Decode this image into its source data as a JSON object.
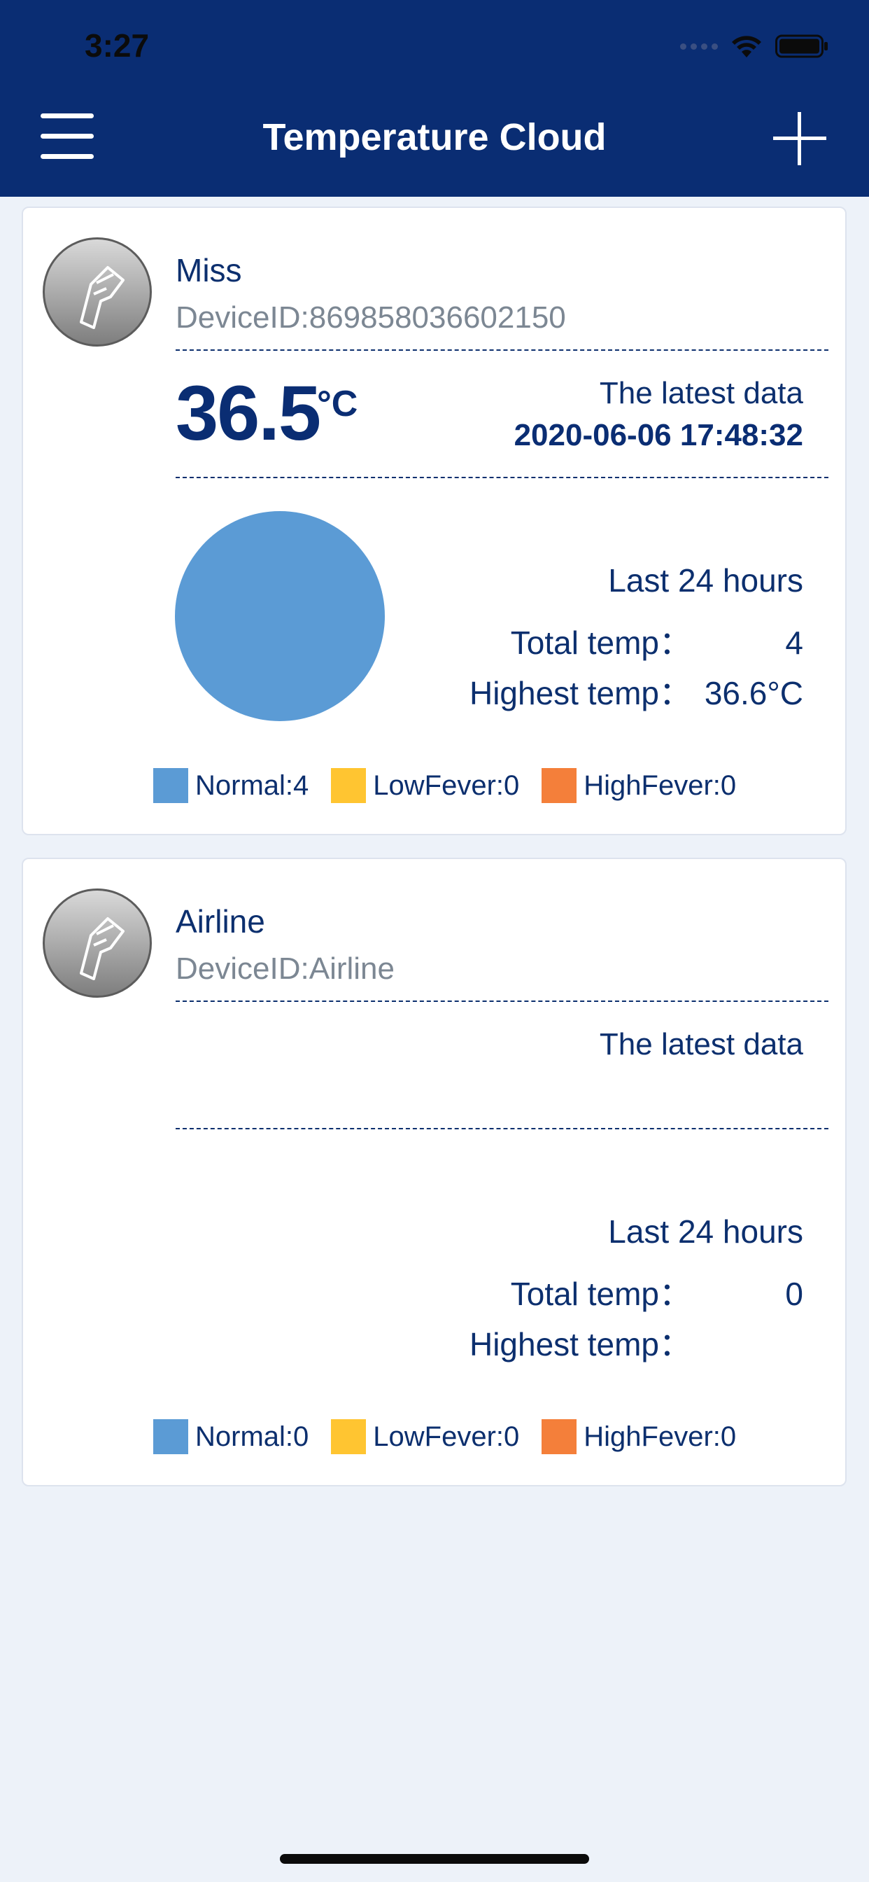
{
  "status_bar": {
    "time": "3:27"
  },
  "header": {
    "title": "Temperature Cloud"
  },
  "colors": {
    "header_bg": "#0a2d73",
    "normal": "#5b9bd5",
    "low_fever": "#ffc531",
    "high_fever": "#f47f3a"
  },
  "devices": [
    {
      "name": "Miss",
      "device_id": "DeviceID:869858036602150",
      "temperature": "36.5",
      "temp_unit": "°C",
      "latest_label": "The latest data",
      "latest_time": "2020-06-06 17:48:32",
      "period_label": "Last 24 hours",
      "total_label": "Total temp：",
      "total_value": "4",
      "highest_label": "Highest temp：",
      "highest_value": "36.6°C",
      "legend": [
        {
          "label": "Normal:4",
          "icon": "normal-swatch"
        },
        {
          "label": "LowFever:0",
          "icon": "low-fever-swatch"
        },
        {
          "label": "HighFever:0",
          "icon": "high-fever-swatch"
        }
      ],
      "chart_data": {
        "type": "pie",
        "categories": [
          "Normal",
          "LowFever",
          "HighFever"
        ],
        "values": [
          4,
          0,
          0
        ]
      }
    },
    {
      "name": "Airline",
      "device_id": "DeviceID:Airline",
      "latest_label": "The latest data",
      "period_label": "Last 24 hours",
      "total_label": "Total temp：",
      "total_value": "0",
      "highest_label": "Highest temp：",
      "highest_value": "",
      "legend": [
        {
          "label": "Normal:0",
          "icon": "normal-swatch"
        },
        {
          "label": "LowFever:0",
          "icon": "low-fever-swatch"
        },
        {
          "label": "HighFever:0",
          "icon": "high-fever-swatch"
        }
      ]
    }
  ]
}
